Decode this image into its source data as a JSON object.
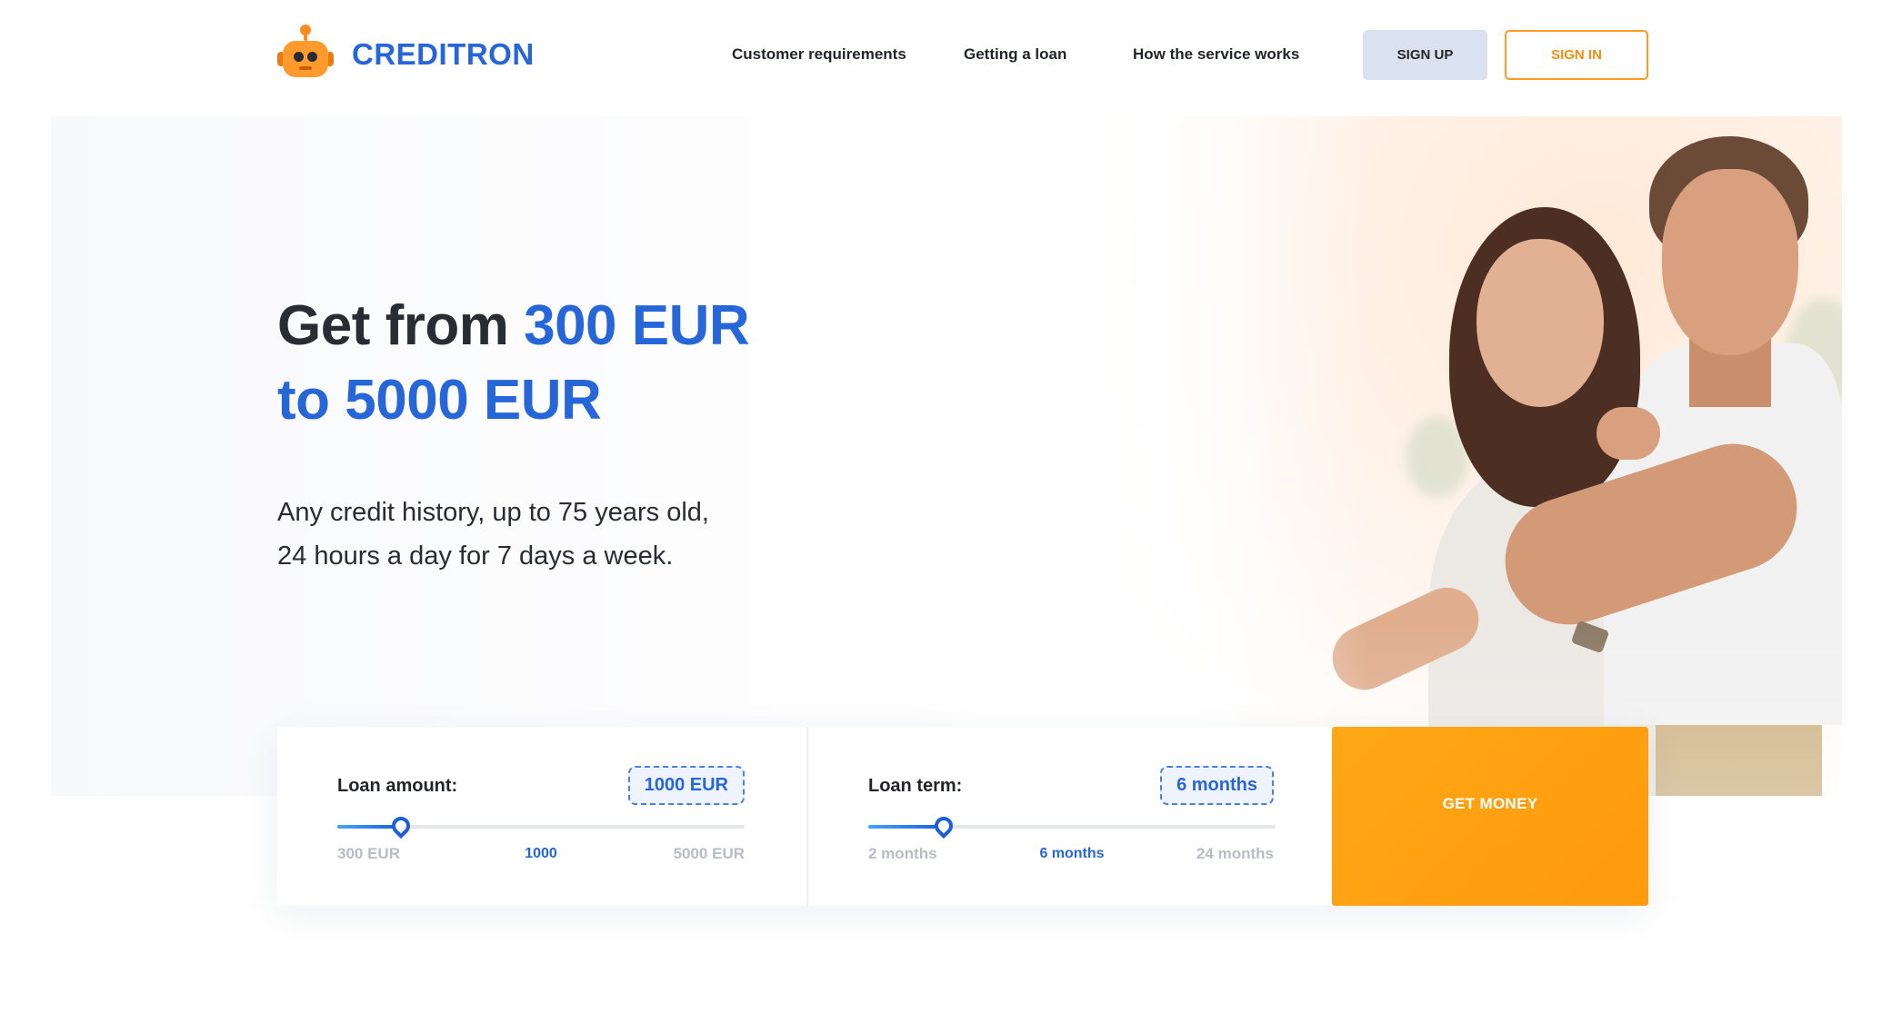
{
  "brand": {
    "name": "CREDITRON",
    "logo_icon": "robot-icon"
  },
  "nav": {
    "items": [
      {
        "label": "Customer requirements"
      },
      {
        "label": "Getting a loan"
      },
      {
        "label": "How the service works"
      }
    ]
  },
  "auth": {
    "sign_up": "SIGN UP",
    "sign_in": "SIGN IN"
  },
  "hero": {
    "headline_prefix": "Get from ",
    "headline_accent_1": "300 EUR",
    "headline_accent_2": "to 5000 EUR",
    "sub_line_1": "Any credit history, up to 75 years old,",
    "sub_line_2": "24 hours a day for 7 days a week."
  },
  "calculator": {
    "amount": {
      "label": "Loan amount:",
      "value_display": "1000 EUR",
      "min_label": "300 EUR",
      "current_label": "1000",
      "max_label": "5000 EUR",
      "min": 300,
      "max": 5000,
      "value": 1000
    },
    "term": {
      "label": "Loan term:",
      "value_display": "6 months",
      "min_label": "2 months",
      "current_label": "6 months",
      "max_label": "24 months",
      "min": 2,
      "max": 24,
      "value": 6
    },
    "submit": "GET MONEY"
  },
  "colors": {
    "accent_blue": "#2766d8",
    "accent_orange": "#ff9a0d"
  }
}
